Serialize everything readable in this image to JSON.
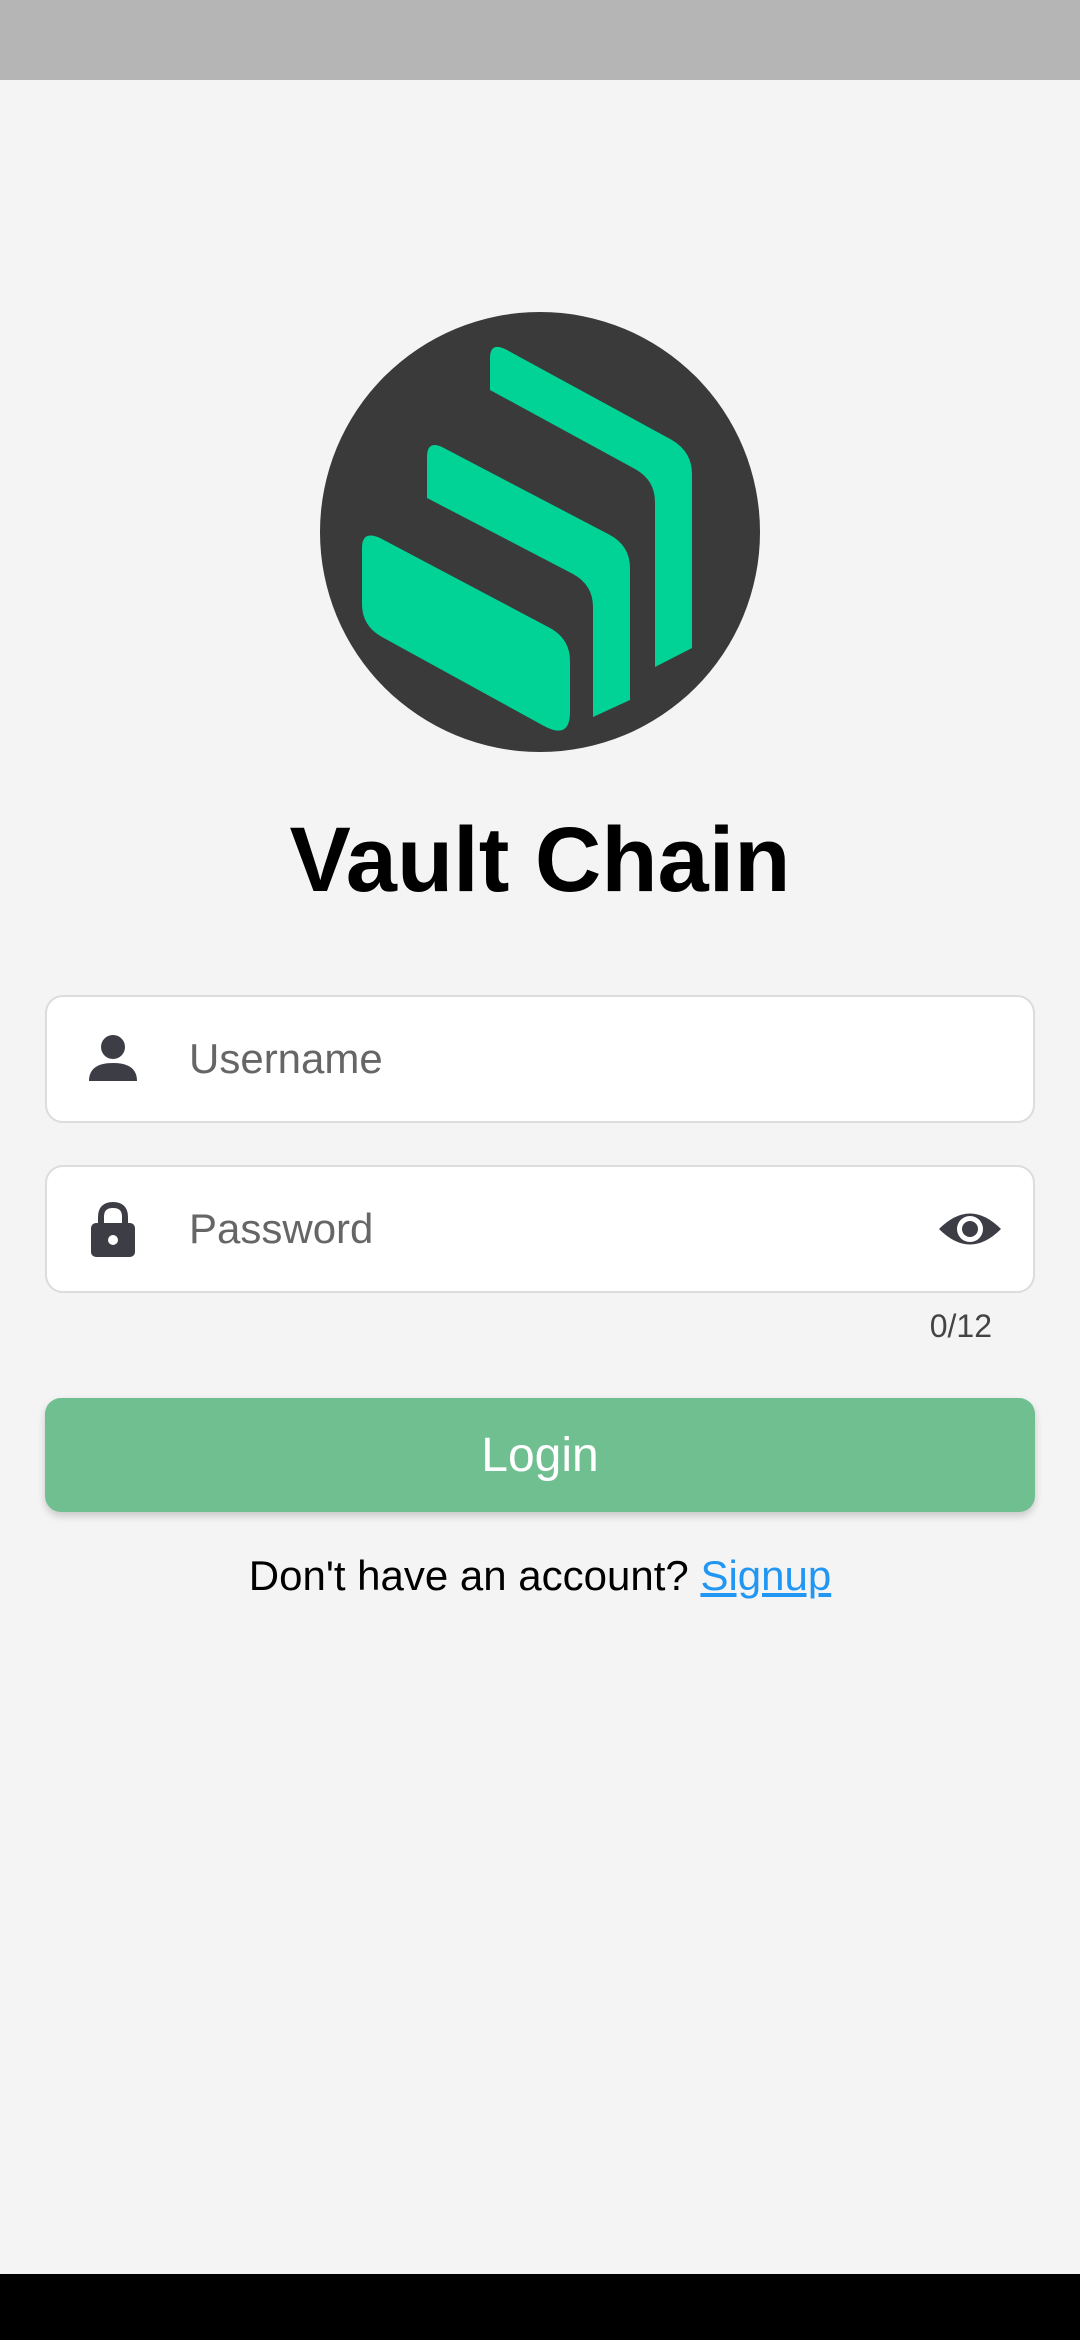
{
  "app": {
    "title": "Vault Chain"
  },
  "form": {
    "username": {
      "placeholder": "Username",
      "value": ""
    },
    "password": {
      "placeholder": "Password",
      "value": "",
      "counter": "0/12"
    },
    "login_label": "Login"
  },
  "signup": {
    "prompt": "Don't have an account?",
    "link_label": "Signup"
  },
  "icons": {
    "username": "person-icon",
    "password": "lock-icon",
    "toggle": "eye-icon"
  },
  "colors": {
    "logo_background": "#3a3a3a",
    "logo_accent": "#00d395",
    "login_button": "#70bf90",
    "link": "#2196f3",
    "icon": "#3d3d46"
  }
}
